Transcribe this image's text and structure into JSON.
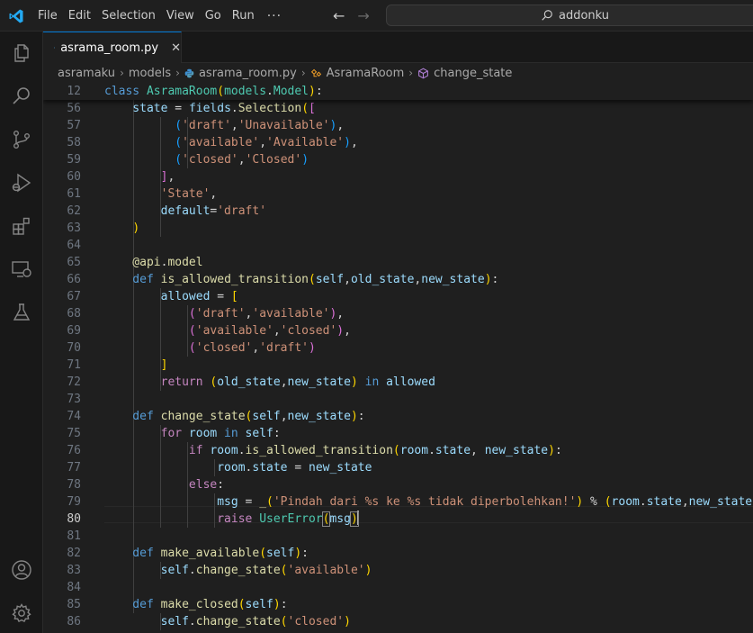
{
  "menu": [
    "File",
    "Edit",
    "Selection",
    "View",
    "Go",
    "Run"
  ],
  "menu_more": "···",
  "search": {
    "text": "addonku"
  },
  "tab": {
    "label": "asrama_room.py",
    "close": "✕"
  },
  "breadcrumb": {
    "items": [
      "asramaku",
      "models",
      "asrama_room.py",
      "AsramaRoom",
      "change_state"
    ],
    "separator": "›"
  },
  "editor": {
    "current_line": "80",
    "lines": [
      {
        "n": "12",
        "tokens": [
          [
            "kw",
            "class "
          ],
          [
            "cls",
            "AsramaRoom"
          ],
          [
            "b1",
            "("
          ],
          [
            "cls",
            "models"
          ],
          [
            "pn",
            "."
          ],
          [
            "cls",
            "Model"
          ],
          [
            "b1",
            ")"
          ],
          [
            "pn",
            ":"
          ]
        ]
      },
      {
        "n": "56",
        "tokens": [
          [
            "var",
            "    state"
          ],
          [
            "op",
            " = "
          ],
          [
            "var",
            "fields"
          ],
          [
            "pn",
            "."
          ],
          [
            "fn",
            "Selection"
          ],
          [
            "b1",
            "("
          ],
          [
            "b2",
            "["
          ]
        ]
      },
      {
        "n": "57",
        "tokens": [
          [
            "pn",
            "          "
          ],
          [
            "b3",
            "("
          ],
          [
            "str",
            "'draft'"
          ],
          [
            "pn",
            ","
          ],
          [
            "str",
            "'Unavailable'"
          ],
          [
            "b3",
            ")"
          ],
          [
            "pn",
            ","
          ]
        ]
      },
      {
        "n": "58",
        "tokens": [
          [
            "pn",
            "          "
          ],
          [
            "b3",
            "("
          ],
          [
            "str",
            "'available'"
          ],
          [
            "pn",
            ","
          ],
          [
            "str",
            "'Available'"
          ],
          [
            "b3",
            ")"
          ],
          [
            "pn",
            ","
          ]
        ]
      },
      {
        "n": "59",
        "tokens": [
          [
            "pn",
            "          "
          ],
          [
            "b3",
            "("
          ],
          [
            "str",
            "'closed'"
          ],
          [
            "pn",
            ","
          ],
          [
            "str",
            "'Closed'"
          ],
          [
            "b3",
            ")"
          ]
        ]
      },
      {
        "n": "60",
        "tokens": [
          [
            "pn",
            "        "
          ],
          [
            "b2",
            "]"
          ],
          [
            "pn",
            ","
          ]
        ]
      },
      {
        "n": "61",
        "tokens": [
          [
            "pn",
            "        "
          ],
          [
            "str",
            "'State'"
          ],
          [
            "pn",
            ","
          ]
        ]
      },
      {
        "n": "62",
        "tokens": [
          [
            "var",
            "        default"
          ],
          [
            "op",
            "="
          ],
          [
            "str",
            "'draft'"
          ]
        ]
      },
      {
        "n": "63",
        "tokens": [
          [
            "pn",
            "    "
          ],
          [
            "b1",
            ")"
          ]
        ]
      },
      {
        "n": "64",
        "tokens": []
      },
      {
        "n": "65",
        "tokens": [
          [
            "fn",
            "    @"
          ],
          [
            "fn",
            "api"
          ],
          [
            "pn",
            "."
          ],
          [
            "fn",
            "model"
          ]
        ]
      },
      {
        "n": "66",
        "tokens": [
          [
            "kw",
            "    def "
          ],
          [
            "fn",
            "is_allowed_transition"
          ],
          [
            "b1",
            "("
          ],
          [
            "var",
            "self"
          ],
          [
            "pn",
            ","
          ],
          [
            "var",
            "old_state"
          ],
          [
            "pn",
            ","
          ],
          [
            "var",
            "new_state"
          ],
          [
            "b1",
            ")"
          ],
          [
            "pn",
            ":"
          ]
        ]
      },
      {
        "n": "67",
        "tokens": [
          [
            "var",
            "        allowed"
          ],
          [
            "op",
            " = "
          ],
          [
            "b1",
            "["
          ]
        ]
      },
      {
        "n": "68",
        "tokens": [
          [
            "pn",
            "            "
          ],
          [
            "b2",
            "("
          ],
          [
            "str",
            "'draft'"
          ],
          [
            "pn",
            ","
          ],
          [
            "str",
            "'available'"
          ],
          [
            "b2",
            ")"
          ],
          [
            "pn",
            ","
          ]
        ]
      },
      {
        "n": "69",
        "tokens": [
          [
            "pn",
            "            "
          ],
          [
            "b2",
            "("
          ],
          [
            "str",
            "'available'"
          ],
          [
            "pn",
            ","
          ],
          [
            "str",
            "'closed'"
          ],
          [
            "b2",
            ")"
          ],
          [
            "pn",
            ","
          ]
        ]
      },
      {
        "n": "70",
        "tokens": [
          [
            "pn",
            "            "
          ],
          [
            "b2",
            "("
          ],
          [
            "str",
            "'closed'"
          ],
          [
            "pn",
            ","
          ],
          [
            "str",
            "'draft'"
          ],
          [
            "b2",
            ")"
          ]
        ]
      },
      {
        "n": "71",
        "tokens": [
          [
            "pn",
            "        "
          ],
          [
            "b1",
            "]"
          ]
        ]
      },
      {
        "n": "72",
        "tokens": [
          [
            "ctl",
            "        return "
          ],
          [
            "b1",
            "("
          ],
          [
            "var",
            "old_state"
          ],
          [
            "pn",
            ","
          ],
          [
            "var",
            "new_state"
          ],
          [
            "b1",
            ")"
          ],
          [
            "kw",
            " in "
          ],
          [
            "var",
            "allowed"
          ]
        ]
      },
      {
        "n": "73",
        "tokens": []
      },
      {
        "n": "74",
        "tokens": [
          [
            "kw",
            "    def "
          ],
          [
            "fn",
            "change_state"
          ],
          [
            "b1",
            "("
          ],
          [
            "var",
            "self"
          ],
          [
            "pn",
            ","
          ],
          [
            "var",
            "new_state"
          ],
          [
            "b1",
            ")"
          ],
          [
            "pn",
            ":"
          ]
        ]
      },
      {
        "n": "75",
        "tokens": [
          [
            "ctl",
            "        for "
          ],
          [
            "var",
            "room"
          ],
          [
            "kw",
            " in "
          ],
          [
            "var",
            "self"
          ],
          [
            "pn",
            ":"
          ]
        ]
      },
      {
        "n": "76",
        "tokens": [
          [
            "ctl",
            "            if "
          ],
          [
            "var",
            "room"
          ],
          [
            "pn",
            "."
          ],
          [
            "fn",
            "is_allowed_transition"
          ],
          [
            "b1",
            "("
          ],
          [
            "var",
            "room"
          ],
          [
            "pn",
            "."
          ],
          [
            "var",
            "state"
          ],
          [
            "pn",
            ", "
          ],
          [
            "var",
            "new_state"
          ],
          [
            "b1",
            ")"
          ],
          [
            "pn",
            ":"
          ]
        ]
      },
      {
        "n": "77",
        "tokens": [
          [
            "var",
            "                room"
          ],
          [
            "pn",
            "."
          ],
          [
            "var",
            "state"
          ],
          [
            "op",
            " = "
          ],
          [
            "var",
            "new_state"
          ]
        ]
      },
      {
        "n": "78",
        "tokens": [
          [
            "ctl",
            "            else"
          ],
          [
            "pn",
            ":"
          ]
        ]
      },
      {
        "n": "79",
        "tokens": [
          [
            "var",
            "                msg"
          ],
          [
            "op",
            " = "
          ],
          [
            "fn",
            "_"
          ],
          [
            "b1",
            "("
          ],
          [
            "str",
            "'Pindah dari %s ke %s tidak diperbolehkan!'"
          ],
          [
            "b1",
            ")"
          ],
          [
            "op",
            " % "
          ],
          [
            "b1",
            "("
          ],
          [
            "var",
            "room"
          ],
          [
            "pn",
            "."
          ],
          [
            "var",
            "state"
          ],
          [
            "pn",
            ","
          ],
          [
            "var",
            "new_state"
          ],
          [
            "b1",
            ")"
          ]
        ]
      },
      {
        "n": "80",
        "tokens": [
          [
            "ctl",
            "                raise "
          ],
          [
            "cls",
            "UserError"
          ],
          [
            "b1",
            "("
          ],
          [
            "var",
            "msg"
          ],
          [
            "b1",
            ")"
          ]
        ]
      },
      {
        "n": "81",
        "tokens": []
      },
      {
        "n": "82",
        "tokens": [
          [
            "kw",
            "    def "
          ],
          [
            "fn",
            "make_available"
          ],
          [
            "b1",
            "("
          ],
          [
            "var",
            "self"
          ],
          [
            "b1",
            ")"
          ],
          [
            "pn",
            ":"
          ]
        ]
      },
      {
        "n": "83",
        "tokens": [
          [
            "var",
            "        self"
          ],
          [
            "pn",
            "."
          ],
          [
            "fn",
            "change_state"
          ],
          [
            "b1",
            "("
          ],
          [
            "str",
            "'available'"
          ],
          [
            "b1",
            ")"
          ]
        ]
      },
      {
        "n": "84",
        "tokens": []
      },
      {
        "n": "85",
        "tokens": [
          [
            "kw",
            "    def "
          ],
          [
            "fn",
            "make_closed"
          ],
          [
            "b1",
            "("
          ],
          [
            "var",
            "self"
          ],
          [
            "b1",
            ")"
          ],
          [
            "pn",
            ":"
          ]
        ]
      },
      {
        "n": "86",
        "tokens": [
          [
            "var",
            "        self"
          ],
          [
            "pn",
            "."
          ],
          [
            "fn",
            "change_state"
          ],
          [
            "b1",
            "("
          ],
          [
            "str",
            "'closed'"
          ],
          [
            "b1",
            ")"
          ]
        ]
      }
    ]
  },
  "icons": {
    "activity": [
      "explorer-icon",
      "search-icon",
      "source-control-icon",
      "run-debug-icon",
      "extensions-icon",
      "remote-explorer-icon",
      "testing-icon"
    ],
    "activity_bottom": [
      "accounts-icon",
      "manage-gear-icon"
    ]
  },
  "colors": {
    "accent": "#0078d4",
    "editor_bg": "#1f1f1f",
    "keyword": "#569cd6",
    "control": "#c586c0",
    "class": "#4ec9b0",
    "function": "#dcdcaa",
    "string": "#ce9178",
    "variable": "#9cdcfe"
  }
}
